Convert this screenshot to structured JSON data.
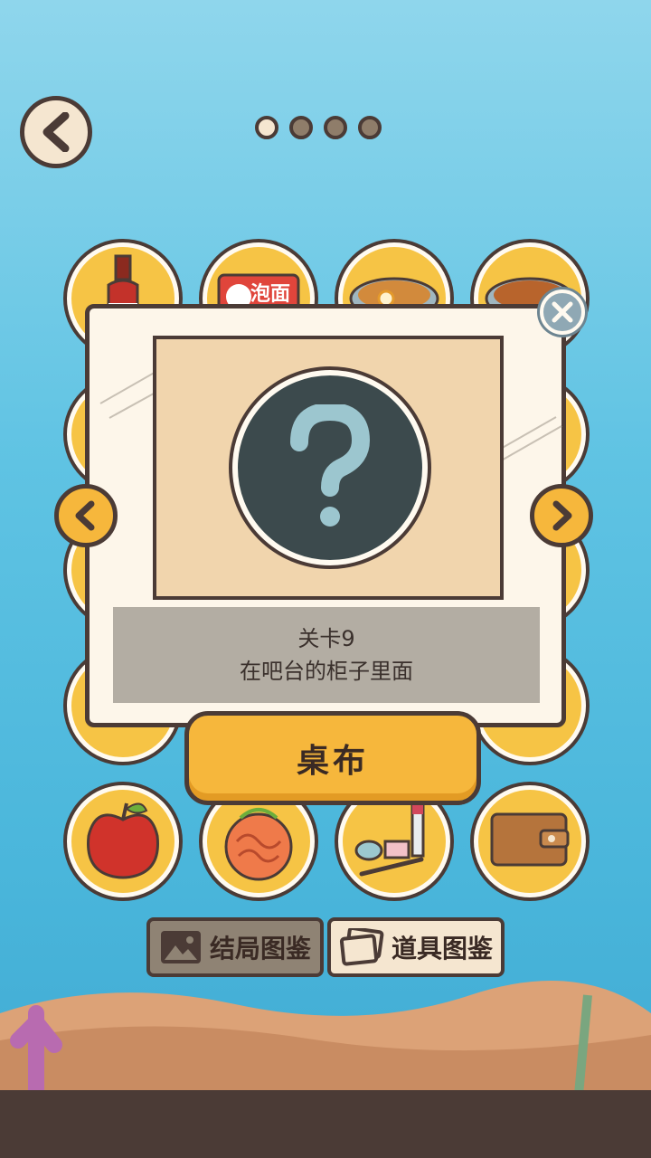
{
  "pager": {
    "page_count": 4,
    "active_index": 0
  },
  "modal": {
    "hint_line1": "关卡9",
    "hint_line2": "在吧台的柜子里面",
    "item_name": "桌布"
  },
  "tabs": {
    "ending_gallery": "结局图鉴",
    "item_gallery": "道具图鉴"
  },
  "colors": {
    "accent": "#f6b73c",
    "outline": "#4b3b36",
    "panel": "#fdf6ea",
    "item_bg": "#f6c445",
    "mystery_bg": "#3c4a4d"
  },
  "icons": {
    "back": "chevron-left-icon",
    "close": "close-icon",
    "prev": "chevron-left-icon",
    "next": "chevron-right-icon",
    "mystery": "question-mark-icon",
    "ending_tab": "image-icon",
    "item_tab": "photos-icon"
  },
  "item_grid": [
    {
      "name": "cola-bottle",
      "label_text": ""
    },
    {
      "name": "instant-noodles",
      "label_text": "泡面"
    },
    {
      "name": "noodle-bowl",
      "label_text": ""
    },
    {
      "name": "noodle-bowl-deluxe",
      "label_text": ""
    },
    {
      "name": "apple",
      "label_text": ""
    },
    {
      "name": "brain-coral",
      "label_text": ""
    },
    {
      "name": "makeup-kit",
      "label_text": ""
    },
    {
      "name": "wallet",
      "label_text": ""
    }
  ]
}
